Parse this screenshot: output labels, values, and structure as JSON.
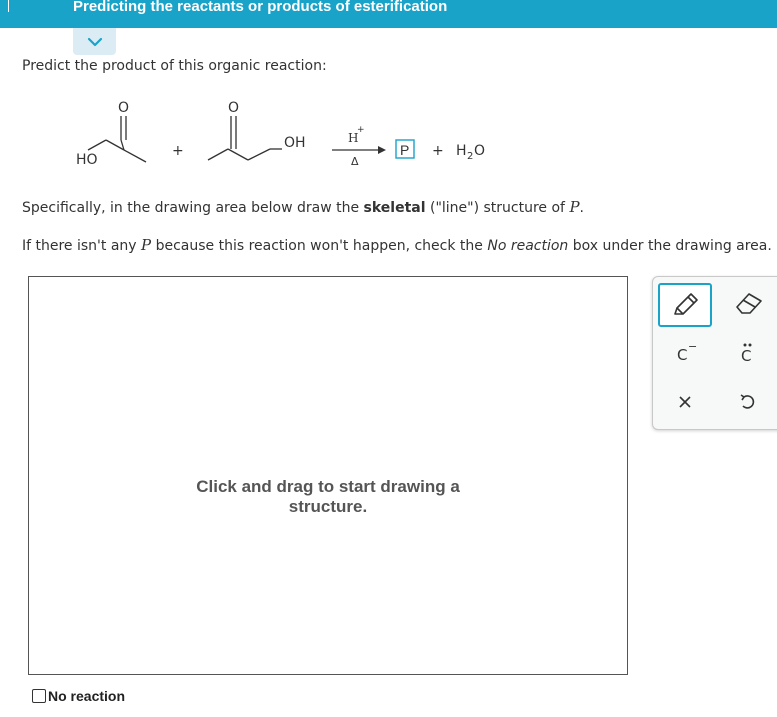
{
  "header": {
    "title": "Predicting the reactants or products of esterification"
  },
  "prompt": "Predict the product of this organic reaction:",
  "reaction": {
    "atom_o": "O",
    "ho_label": "HO",
    "oh_label": "OH",
    "plus": "+",
    "catalyst": "H",
    "catalyst_charge": "+",
    "heat": "Δ",
    "product_box": "P",
    "water_h": "H",
    "water_sub": "2",
    "water_o": "O"
  },
  "instructions": {
    "line1_a": "Specifically, in the drawing area below draw the ",
    "line1_b": "skeletal",
    "line1_c": " (\"line\") structure of ",
    "line1_var": "P",
    "line1_d": ".",
    "line2_a": "If there isn't any ",
    "line2_var": "P",
    "line2_b": " because this reaction won't happen, check the ",
    "line2_em": "No reaction",
    "line2_c": " box under the drawing area."
  },
  "canvas": {
    "hint_line1": "Click and drag to start drawing a",
    "hint_line2": "structure."
  },
  "toolbox": {
    "carbanion": "C",
    "carbanion_charge": "−",
    "lone_pair_c": "C",
    "tools": [
      "pencil-icon",
      "eraser-icon",
      "carbanion-icon",
      "lone-pair-icon",
      "clear-icon",
      "undo-icon"
    ]
  },
  "no_reaction": {
    "label": "No reaction",
    "checked": false
  },
  "colors": {
    "header": "#1aa3c9",
    "accent": "#1aa3c9",
    "text": "#333333"
  }
}
